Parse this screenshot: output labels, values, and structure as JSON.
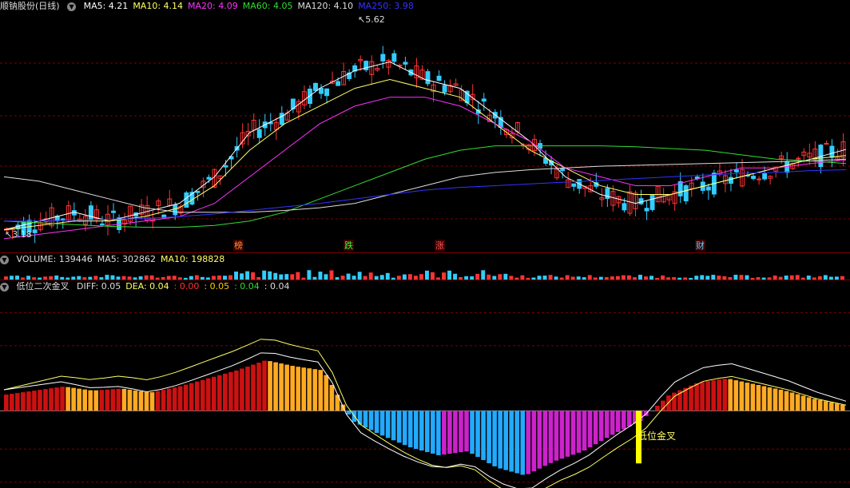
{
  "price_panel": {
    "stock_name": "顺钠股份(日线)",
    "ma_labels": [
      {
        "text": "MA5: 4.21",
        "color": "#ffffff"
      },
      {
        "text": "MA10: 4.14",
        "color": "#ffff66"
      },
      {
        "text": "MA20: 4.09",
        "color": "#ff33ff"
      },
      {
        "text": "MA60: 4.05",
        "color": "#33dd33"
      },
      {
        "text": "MA120: 4.10",
        "color": "#dddddd"
      },
      {
        "text": "MA250: 3.98",
        "color": "#3333ff"
      }
    ],
    "high_label": "5.62",
    "low_label": "3.18",
    "event_markers": [
      {
        "text": "榜",
        "color": "#ff9933"
      },
      {
        "text": "跌",
        "color": "#33ff33"
      },
      {
        "text": "涨",
        "color": "#ff5555"
      },
      {
        "text": "财",
        "color": "#66ccff"
      }
    ]
  },
  "volume_panel": {
    "labels": [
      {
        "text": "VOLUME: 139446",
        "color": "#dddddd"
      },
      {
        "text": "MA5: 302862",
        "color": "#dddddd"
      },
      {
        "text": "MA10: 198828",
        "color": "#ffff66"
      }
    ]
  },
  "indicator_panel": {
    "title": "低位二次金叉",
    "labels": [
      {
        "text": "DIFF: 0.05",
        "color": "#dddddd"
      },
      {
        "text": "DEA: 0.04",
        "color": "#ffff66"
      },
      {
        "text": ": 0.00",
        "color": "#ff3333"
      },
      {
        "text": ": 0.05",
        "color": "#ffcc00"
      },
      {
        "text": ": 0.04",
        "color": "#33dd33"
      },
      {
        "text": ": 0.04",
        "color": "#dddddd"
      }
    ],
    "signal_label": "低位金叉"
  },
  "colors": {
    "up": "#ff3333",
    "down": "#33ccff",
    "grid": "#7a0000",
    "hist_red": "#cc1111",
    "hist_orange": "#ffaa22",
    "hist_blue": "#22aaff",
    "hist_magenta": "#cc22cc"
  },
  "chart_data": [
    {
      "type": "candlestick",
      "title": "顺钠股份(日线)",
      "ylim": [
        3.1,
        5.7
      ],
      "annotations": [
        "5.62",
        "3.18"
      ],
      "series": [
        {
          "name": "MA5",
          "values_approx": [
            3.3,
            3.4,
            3.5,
            3.4,
            3.5,
            3.6,
            3.9,
            4.4,
            4.6,
            4.9,
            5.1,
            5.2,
            5.0,
            4.9,
            4.6,
            4.3,
            3.9,
            3.7,
            3.6,
            3.7,
            3.8,
            3.9,
            4.0,
            4.1,
            4.21
          ]
        },
        {
          "name": "MA10",
          "values_approx": [
            3.3,
            3.35,
            3.4,
            3.4,
            3.45,
            3.55,
            3.8,
            4.2,
            4.5,
            4.7,
            4.9,
            5.0,
            4.9,
            4.8,
            4.5,
            4.2,
            4.0,
            3.8,
            3.7,
            3.7,
            3.8,
            3.9,
            4.0,
            4.1,
            4.14
          ]
        },
        {
          "name": "MA20",
          "values_approx": [
            3.2,
            3.25,
            3.3,
            3.35,
            3.4,
            3.45,
            3.6,
            3.9,
            4.2,
            4.5,
            4.7,
            4.8,
            4.8,
            4.7,
            4.5,
            4.3,
            4.0,
            3.9,
            3.8,
            3.8,
            3.9,
            4.0,
            4.0,
            4.05,
            4.09
          ]
        },
        {
          "name": "MA60",
          "values_approx": [
            3.4,
            3.38,
            3.36,
            3.34,
            3.33,
            3.33,
            3.35,
            3.4,
            3.5,
            3.65,
            3.8,
            3.95,
            4.1,
            4.2,
            4.25,
            4.25,
            4.25,
            4.25,
            4.24,
            4.22,
            4.2,
            4.15,
            4.1,
            4.08,
            4.05
          ]
        },
        {
          "name": "MA120",
          "values_approx": [
            3.9,
            3.85,
            3.75,
            3.65,
            3.55,
            3.5,
            3.5,
            3.5,
            3.52,
            3.55,
            3.6,
            3.7,
            3.8,
            3.9,
            3.95,
            3.98,
            4.0,
            4.02,
            4.03,
            4.04,
            4.05,
            4.06,
            4.07,
            4.08,
            4.1
          ]
        },
        {
          "name": "MA250",
          "values_approx": [
            3.4,
            3.4,
            3.41,
            3.42,
            3.43,
            3.45,
            3.48,
            3.52,
            3.56,
            3.6,
            3.65,
            3.7,
            3.75,
            3.78,
            3.8,
            3.82,
            3.84,
            3.86,
            3.88,
            3.9,
            3.92,
            3.94,
            3.95,
            3.97,
            3.98
          ]
        }
      ]
    },
    {
      "type": "bar",
      "title": "VOLUME",
      "series": [
        {
          "name": "VOLUME",
          "last_value": 139446
        },
        {
          "name": "MA5",
          "last_value": 302862
        },
        {
          "name": "MA10",
          "last_value": 198828
        }
      ]
    },
    {
      "type": "bar",
      "title": "低位二次金叉",
      "ylim": [
        -0.35,
        0.55
      ],
      "histogram_approx": [
        0.08,
        0.1,
        0.12,
        0.1,
        0.11,
        0.09,
        0.12,
        0.16,
        0.2,
        0.25,
        0.22,
        0.2,
        -0.05,
        -0.12,
        -0.18,
        -0.22,
        -0.2,
        -0.28,
        -0.32,
        -0.25,
        -0.2,
        -0.12,
        -0.05,
        0.08,
        0.14,
        0.16,
        0.13,
        0.1,
        0.06,
        0.03
      ],
      "series": [
        {
          "name": "DIFF",
          "last_value": 0.05
        },
        {
          "name": "DEA",
          "last_value": 0.04
        }
      ],
      "annotations": [
        "低位金叉"
      ]
    }
  ]
}
